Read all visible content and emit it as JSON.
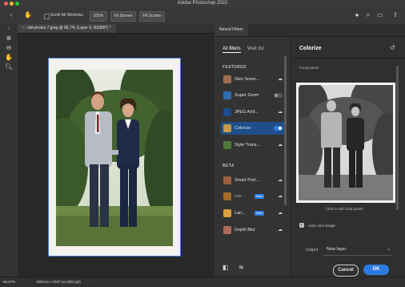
{
  "app": {
    "title": "Adobe Photoshop 2022"
  },
  "options_bar": {
    "scroll_all_windows": "Scroll All Windows",
    "zoom_100": "100%",
    "fit_screen": "Fit Screen",
    "fill_screen": "Fill Screen",
    "icons": [
      "back-icon",
      "hand-icon",
      "account-icon",
      "search-icon",
      "workspace-icon",
      "share-icon"
    ]
  },
  "document": {
    "tab_title": "old-photos 7.jpeg @ 66.7% (Layer 0, RGB/8*) *"
  },
  "status_bar": {
    "zoom": "66.67%",
    "dimensions": "1053 px x 1547 px (300 ppi)"
  },
  "neural_filters": {
    "panel_tab": "Neural Filters",
    "tabs": {
      "all_filters": "All filters",
      "wait_list": "Wait list"
    },
    "featured_label": "FEATURED",
    "beta_label": "BETA",
    "featured": [
      {
        "name": "Skin Smoo...",
        "thumb_color": "#a0704f"
      },
      {
        "name": "Super Zoom",
        "thumb_color": "#2f6fb0"
      },
      {
        "name": "JPEG Artif...",
        "thumb_color": "#1d4d8c"
      },
      {
        "name": "Colorize",
        "thumb_color": "#c89a4a",
        "selected": true
      },
      {
        "name": "Style Trans...",
        "thumb_color": "#4f7a3a"
      }
    ],
    "beta": [
      {
        "name": "Smart Port...",
        "thumb_color": "#9b6040"
      },
      {
        "name": "Har...",
        "thumb_color": "#a36a2a",
        "badge": "New"
      },
      {
        "name": "Lan...",
        "thumb_color": "#d8a040",
        "badge": "New"
      },
      {
        "name": "Depth Blur",
        "thumb_color": "#b06a5a"
      }
    ],
    "detail": {
      "title": "Colorize",
      "focal_points_label": "Focal points",
      "click_hint": "Click to edit focal points",
      "auto_color_label": "Auto color image",
      "output_label": "Output",
      "output_value": "New layer",
      "cancel": "Cancel",
      "ok": "OK"
    },
    "accent": "#2d7be0"
  }
}
